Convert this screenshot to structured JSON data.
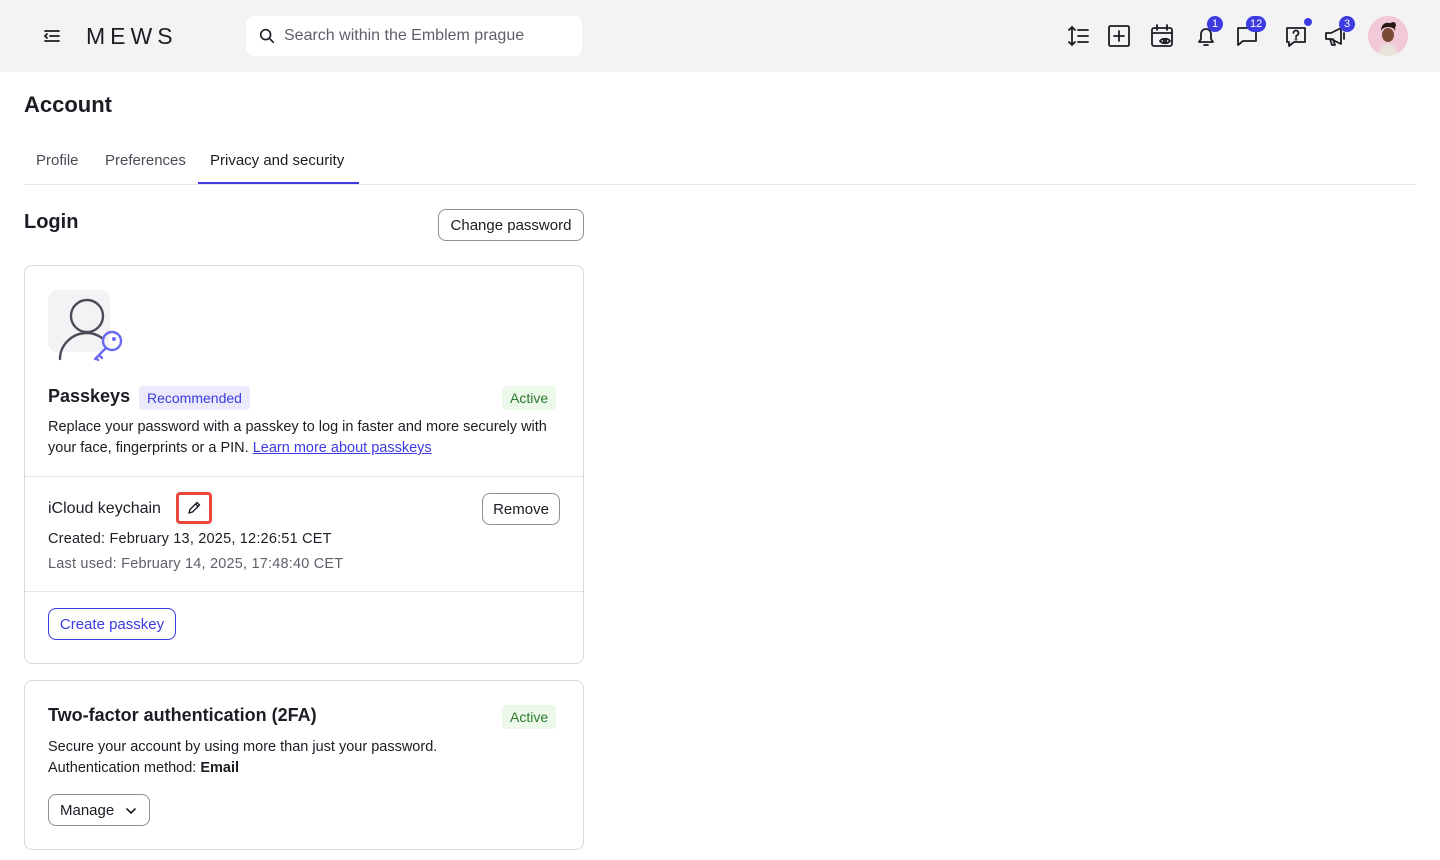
{
  "topbar": {
    "logo_text": "MEWS",
    "search_placeholder": "Search within the Emblem prague",
    "notifications_badge": "1",
    "messages_badge": "12",
    "announcements_badge": "3"
  },
  "page": {
    "title": "Account",
    "tabs": [
      {
        "label": "Profile"
      },
      {
        "label": "Preferences"
      },
      {
        "label": "Privacy and security"
      }
    ]
  },
  "login": {
    "title": "Login",
    "change_password_label": "Change password"
  },
  "passkeys": {
    "title": "Passkeys",
    "recommended_label": "Recommended",
    "status": "Active",
    "description": "Replace your password with a passkey to log in faster and more securely with your face, fingerprints or a PIN.",
    "learn_more": "Learn more about passkeys",
    "item": {
      "name": "iCloud keychain",
      "remove_label": "Remove",
      "created": "Created: February 13, 2025, 12:26:51 CET",
      "last_used": "Last used: February 14, 2025, 17:48:40 CET"
    },
    "create_label": "Create passkey"
  },
  "twofa": {
    "title": "Two-factor authentication (2FA)",
    "status": "Active",
    "description": "Secure your account by using more than just your password.",
    "method_label": "Authentication method:",
    "method_value": "Email",
    "manage_label": "Manage"
  },
  "colors": {
    "accent": "#3d3be0",
    "highlight": "#e8493a",
    "active_bg": "#ecf8ea",
    "active_text": "#2c7a2c"
  }
}
